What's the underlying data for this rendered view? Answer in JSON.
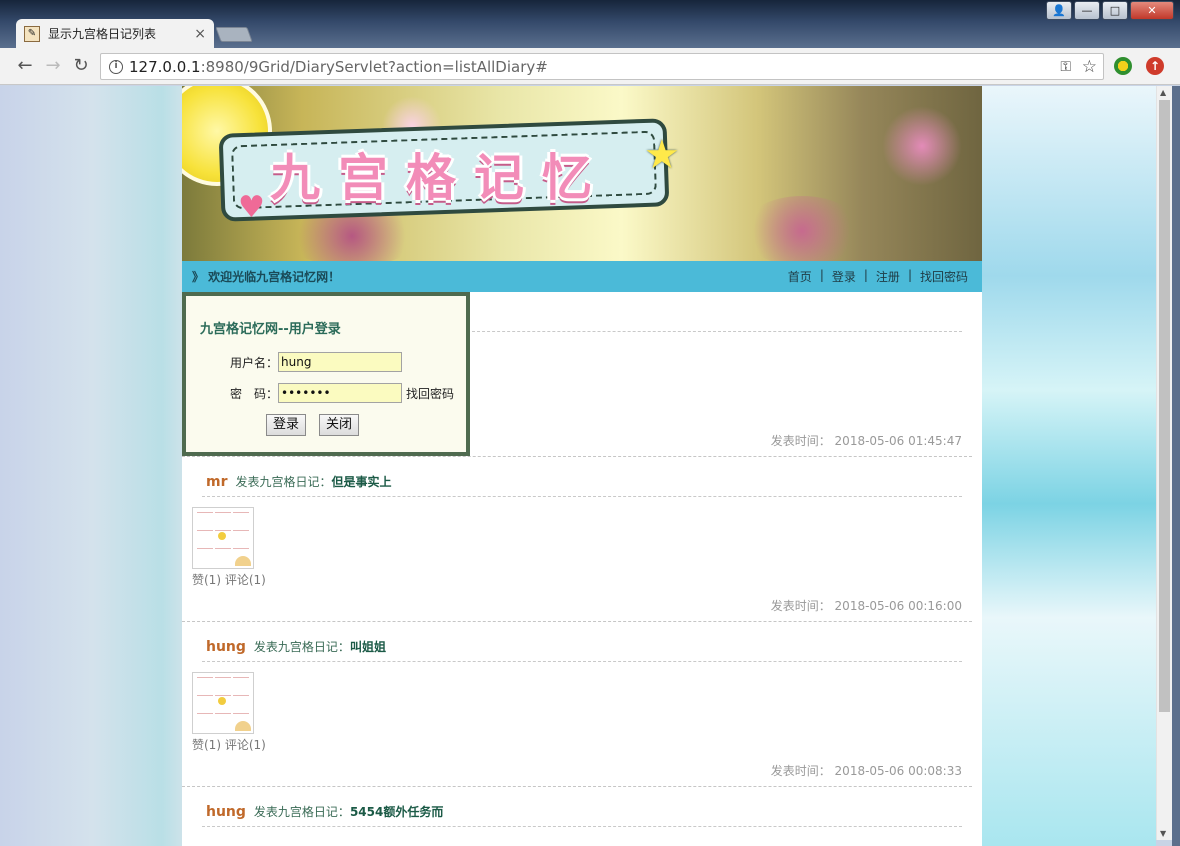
{
  "browser": {
    "tab_title": "显示九宫格日记列表",
    "tab_close": "×",
    "url_host": "127.0.0.1",
    "url_rest": ":8980/9Grid/DiaryServlet?action=listAllDiary#",
    "win_min": "—",
    "win_max": "□",
    "win_close": "✕"
  },
  "banner": {
    "title": "九宫格记忆"
  },
  "navbar": {
    "welcome": "》 欢迎光临九宫格记忆网！",
    "links": [
      "首页",
      "登录",
      "注册",
      "找回密码"
    ],
    "separator": "|"
  },
  "login": {
    "title": "九宫格记忆网--用户登录",
    "username_label": "用户名：",
    "username_value": "hung",
    "password_label": "密　码：",
    "password_value": "•••••••",
    "forgot_link": "找回密码",
    "login_button": "登录",
    "close_button": "关闭"
  },
  "time_prefix": "发表时间：",
  "first_time": "2018-05-06 01:45:47",
  "entries": [
    {
      "user": "mr",
      "label": "发表九宫格日记：",
      "title": "但是事实上",
      "likes": "赞(1) 评论(1)",
      "time": "2018-05-06 00:16:00"
    },
    {
      "user": "hung",
      "label": "发表九宫格日记：",
      "title": "叫姐姐",
      "likes": "赞(1) 评论(1)",
      "time": "2018-05-06 00:08:33"
    },
    {
      "user": "hung",
      "label": "发表九宫格日记：",
      "title": "5454额外任务而"
    }
  ],
  "colors": {
    "navbar_bg": "#4bbad8",
    "username_color": "#c0692a",
    "title_color": "#1b5a46"
  }
}
